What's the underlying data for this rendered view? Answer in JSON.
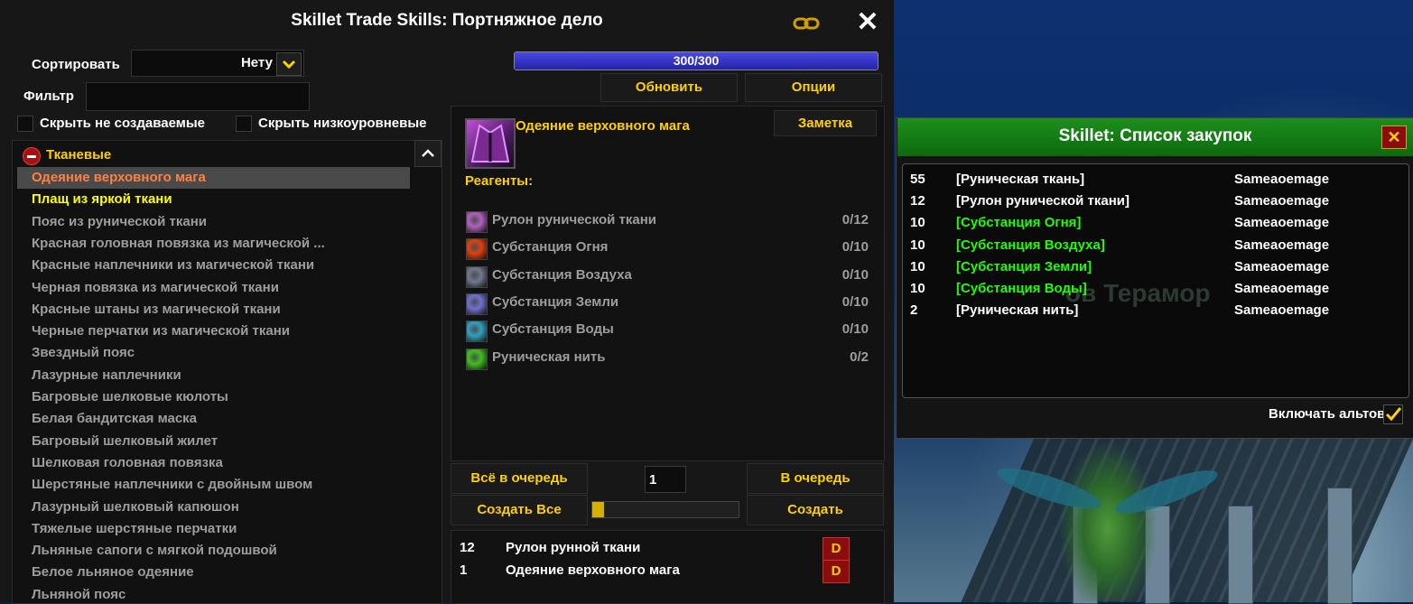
{
  "window": {
    "title": "Skillet Trade Skills: Портняжное дело",
    "close_glyph": "✕"
  },
  "controls": {
    "sort_label": "Сортировать",
    "sort_value": "Нету",
    "filter_label": "Фильтр",
    "filter_value": "",
    "hide_uncraftable_label": "Скрыть не создаваемые",
    "hide_low_level_label": "Скрыть низкоуровневые"
  },
  "skill": {
    "progress_text": "300/300",
    "progress_fraction": 1.0,
    "refresh_label": "Обновить",
    "options_label": "Опции"
  },
  "recipe_list": {
    "category": "Тканевые",
    "items": [
      {
        "name": "Одеяние верховного мага",
        "color": "#ff8040",
        "selected": true
      },
      {
        "name": "Плащ из яркой ткани",
        "color": "#ffff00"
      },
      {
        "name": "Пояс из рунической ткани",
        "color": "#9d9d9d"
      },
      {
        "name": "Красная головная повязка из магической ...",
        "color": "#9d9d9d"
      },
      {
        "name": "Красные наплечники из магической ткани",
        "color": "#9d9d9d"
      },
      {
        "name": "Черная повязка из магической ткани",
        "color": "#9d9d9d"
      },
      {
        "name": "Красные штаны из магической ткани",
        "color": "#9d9d9d"
      },
      {
        "name": "Черные перчатки из магической ткани",
        "color": "#9d9d9d"
      },
      {
        "name": "Звездный пояс",
        "color": "#9d9d9d"
      },
      {
        "name": "Лазурные наплечники",
        "color": "#9d9d9d"
      },
      {
        "name": "Багровые шелковые кюлоты",
        "color": "#9d9d9d"
      },
      {
        "name": "Белая бандитская маска",
        "color": "#9d9d9d"
      },
      {
        "name": "Багровый шелковый жилет",
        "color": "#9d9d9d"
      },
      {
        "name": "Шелковая головная повязка",
        "color": "#9d9d9d"
      },
      {
        "name": "Шерстяные наплечники с двойным швом",
        "color": "#9d9d9d"
      },
      {
        "name": "Лазурный шелковый капюшон",
        "color": "#9d9d9d"
      },
      {
        "name": "Тяжелые шерстяные перчатки",
        "color": "#9d9d9d"
      },
      {
        "name": "Льняные сапоги с мягкой подошвой",
        "color": "#9d9d9d"
      },
      {
        "name": "Белое льняное одеяние",
        "color": "#9d9d9d"
      },
      {
        "name": "Льняной пояс",
        "color": "#9d9d9d"
      }
    ]
  },
  "recipe_detail": {
    "name": "Одеяние верховного мага",
    "note_label": "Заметка",
    "reagents_label": "Реагенты:",
    "reagents": [
      {
        "name": "Рулон рунической ткани",
        "count": "0/12",
        "icon": "cloth-bolt-icon",
        "icon_color": "#b060c0"
      },
      {
        "name": "Субстанция Огня",
        "count": "0/10",
        "icon": "fire-essence-icon",
        "icon_color": "#e04010"
      },
      {
        "name": "Субстанция Воздуха",
        "count": "0/10",
        "icon": "air-essence-icon",
        "icon_color": "#707890"
      },
      {
        "name": "Субстанция Земли",
        "count": "0/10",
        "icon": "earth-essence-icon",
        "icon_color": "#7070d0"
      },
      {
        "name": "Субстанция Воды",
        "count": "0/10",
        "icon": "water-essence-icon",
        "icon_color": "#30a0c0"
      },
      {
        "name": "Руническая нить",
        "count": "0/2",
        "icon": "thread-icon",
        "icon_color": "#40c020"
      }
    ]
  },
  "craft": {
    "queue_all_label": "Всё в очередь",
    "queue_label": "В очередь",
    "create_all_label": "Создать Все",
    "create_label": "Создать",
    "quantity": "1",
    "progress_fraction": 0.08
  },
  "queue": [
    {
      "count": "12",
      "name": "Рулон рунной ткани",
      "delete_label": "D"
    },
    {
      "count": "1",
      "name": "Одеяние верховного мага",
      "delete_label": "D"
    }
  ],
  "shopping": {
    "title": "Skillet: Список закупок",
    "close_glyph": "✕",
    "background_text": "ов Терамор",
    "include_alts_label": "Включать альтов",
    "include_alts_checked": true,
    "items": [
      {
        "count": "55",
        "name": "[Руническая ткань]",
        "owner": "Sameaoemage",
        "green": false
      },
      {
        "count": "12",
        "name": "[Рулон рунической ткани]",
        "owner": "Sameaoemage",
        "green": false
      },
      {
        "count": "10",
        "name": "[Субстанция Огня]",
        "owner": "Sameaoemage",
        "green": true
      },
      {
        "count": "10",
        "name": "[Субстанция Воздуха]",
        "owner": "Sameaoemage",
        "green": true
      },
      {
        "count": "10",
        "name": "[Субстанция Земли]",
        "owner": "Sameaoemage",
        "green": true
      },
      {
        "count": "10",
        "name": "[Субстанция Воды]",
        "owner": "Sameaoemage",
        "green": true
      },
      {
        "count": "2",
        "name": "[Руническая нить]",
        "owner": "Sameaoemage",
        "green": false
      }
    ]
  }
}
